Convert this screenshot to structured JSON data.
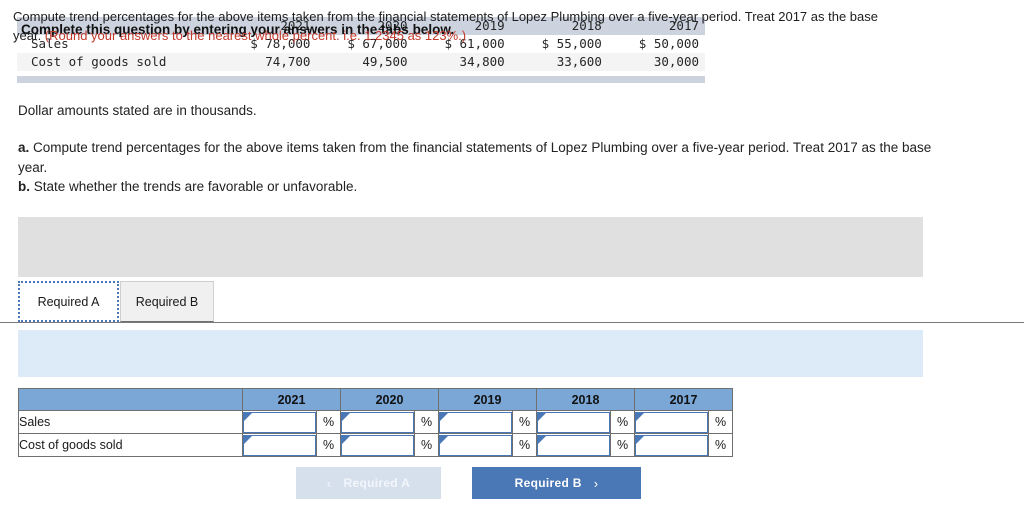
{
  "data_table": {
    "columns": [
      "",
      "2021",
      "2020",
      "2019",
      "2018",
      "2017"
    ],
    "rows": [
      {
        "label": "Sales",
        "values": [
          "$ 78,000",
          "$ 67,000",
          "$ 61,000",
          "$ 55,000",
          "$ 50,000"
        ]
      },
      {
        "label": "Cost of goods sold",
        "values": [
          "74,700",
          "49,500",
          "34,800",
          "33,600",
          "30,000"
        ]
      }
    ]
  },
  "note": "Dollar amounts stated are in thousands.",
  "prompt": {
    "a_label": "a.",
    "a_text": " Compute trend percentages for the above items taken from the financial statements of Lopez Plumbing over a five-year period. Treat 2017 as the base year.",
    "b_label": "b.",
    "b_text": " State whether the trends are favorable or unfavorable."
  },
  "banner": {
    "text": "Complete this question by entering your answers in the tabs below."
  },
  "tabs": [
    {
      "label": "Required A",
      "active": true
    },
    {
      "label": "Required B",
      "active": false
    }
  ],
  "requirement": {
    "text": "Compute trend percentages for the above items taken from the financial statements of Lopez Plumbing over a five-year period. Treat 2017 as the base year. ",
    "note_red": "(Round your answers to the nearest whole percent. i.e. 1.2345 as 123%.)"
  },
  "answer_table": {
    "corner_header": "",
    "year_headers": [
      "2021",
      "2020",
      "2019",
      "2018",
      "2017"
    ],
    "percent_symbol": "%",
    "rows": [
      {
        "label": "Sales",
        "values": [
          "",
          "",
          "",
          "",
          ""
        ]
      },
      {
        "label": "Cost of goods sold",
        "values": [
          "",
          "",
          "",
          "",
          ""
        ]
      }
    ]
  },
  "footer": {
    "prev_label": "Required A",
    "prev_chevron": "‹",
    "next_label": "Required B",
    "next_chevron": "›"
  },
  "colors": {
    "header_band": "#ccd3df",
    "banner_gray": "#e0e0e0",
    "panel_blue": "#ddeaf7",
    "table_header_blue": "#7ba7d7",
    "accent_blue": "#4a77b5",
    "disabled_blue": "#d6e0ed",
    "red_note": "#c0392b"
  }
}
